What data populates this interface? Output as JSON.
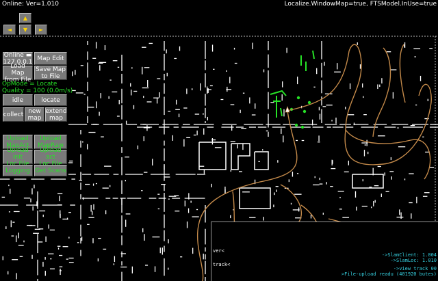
{
  "topbar": {
    "left_text": "Online: Ver=1.010",
    "right_text": "Localize.WindowMap=true, FTSModel.InUse=true"
  },
  "nav": {
    "up": "▲",
    "left": "◄",
    "down": "▼",
    "right": "►"
  },
  "buttons": {
    "online": "Online ▬\n127.0.0.1",
    "map_edit": "Map Edit",
    "load_map": "Load Map\nfrom File",
    "save_map": "Save Map\nto File",
    "idle": "idle",
    "locate": "locate",
    "collect": "collect",
    "new_map": "new\nmap",
    "extend_map": "extend\nmap",
    "upload_mapact": "Upload\nMapAct",
    "upload_mapraw": "Upload\nMapRaw",
    "upload_initlfile": "Upload init\nLoc File",
    "upload_actlfile": "Upload act\nLoc File",
    "logging": "Logging",
    "get_scans": "Get Scans"
  },
  "status": {
    "opmode": "OpMode = Locate",
    "quality": "Quality = 100 (0.0m/s)"
  },
  "console": {
    "lines_left": [
      "ver<",
      "track<"
    ],
    "lines_right": [
      "->SlamClient: 1.004",
      "->SlamLoc: 1.010",
      "->view track 00",
      ">File-upload readu (401920 butes)"
    ]
  },
  "colors": {
    "map_walls": "#ffffff",
    "trajectory": "#c48a4a",
    "highlight": "#27e327",
    "console_text": "#36d0e0",
    "button_face": "#7a7a7a",
    "arrow_glyph": "#ffd400"
  }
}
